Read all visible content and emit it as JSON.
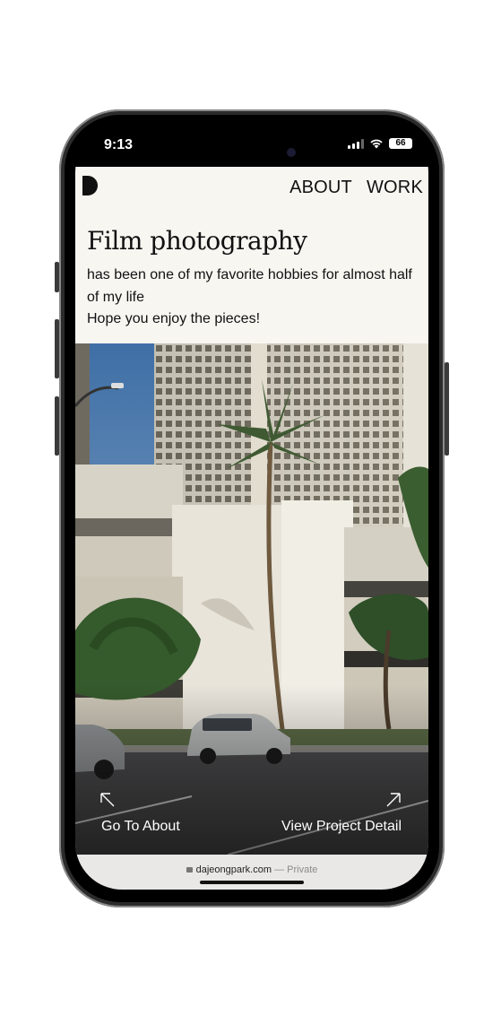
{
  "status_bar": {
    "time": "9:13",
    "battery": "66"
  },
  "site": {
    "nav": {
      "about": "ABOUT",
      "work": "WORK"
    },
    "heading": "Film photography",
    "description_line1": "has been one of my favorite hobbies for almost half of my life",
    "description_line2": "Hope you enjoy the pieces!",
    "links": {
      "about": "Go To About",
      "project": "View Project Detail"
    }
  },
  "browser": {
    "domain": "dajeongpark.com",
    "privacy": "— Private"
  },
  "colors": {
    "page_bg": "#f8f6f1",
    "text": "#111111",
    "bezel": "#2b2b2b"
  }
}
